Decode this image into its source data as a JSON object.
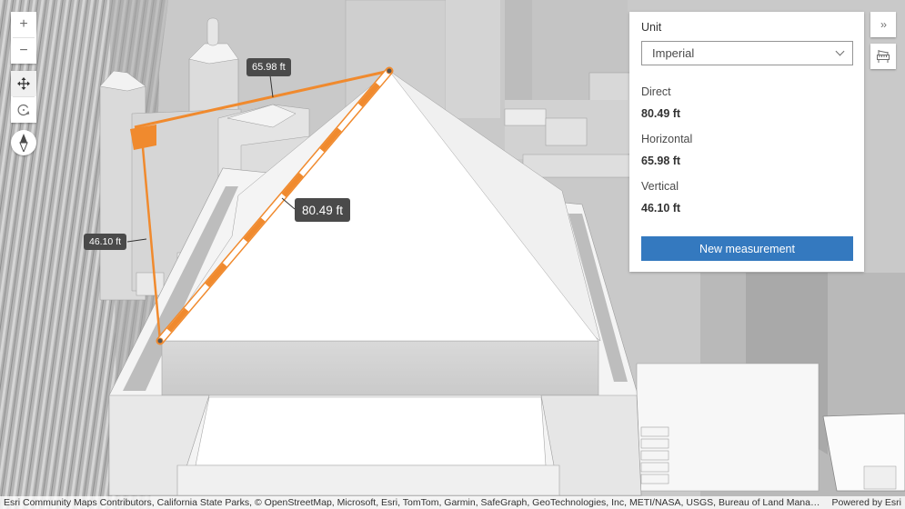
{
  "map_controls": {
    "zoom_in_icon": "plus-icon",
    "zoom_out_icon": "minus-icon",
    "pan_icon": "move-arrows-icon",
    "rotate_icon": "rotate-icon",
    "compass_icon": "compass-icon",
    "zoom_in_glyph": "+",
    "zoom_out_glyph": "−"
  },
  "panel": {
    "unit_label": "Unit",
    "unit_selected": "Imperial",
    "metrics": [
      {
        "label": "Direct",
        "value": "80.49 ft"
      },
      {
        "label": "Horizontal",
        "value": "65.98 ft"
      },
      {
        "label": "Vertical",
        "value": "46.10 ft"
      }
    ],
    "new_measurement_label": "New measurement"
  },
  "side_buttons": {
    "collapse_glyph": "››",
    "collapse_icon": "double-chevron-right-icon",
    "measure_icon": "line-measurement-icon"
  },
  "measurement_labels": {
    "direct": "80.49 ft",
    "horizontal": "65.98 ft",
    "vertical": "46.10 ft"
  },
  "colors": {
    "measurement_line": "#f08a2e",
    "button_blue": "#3479bf",
    "label_bg": "#4a4a4a"
  },
  "attribution": {
    "text": "Esri Community Maps Contributors, California State Parks, © OpenStreetMap, Microsoft, Esri, TomTom, Garmin, SafeGraph, GeoTechnologies, Inc, METI/NASA, USGS, Bureau of Land Managem...",
    "powered_by": "Powered by Esri"
  }
}
